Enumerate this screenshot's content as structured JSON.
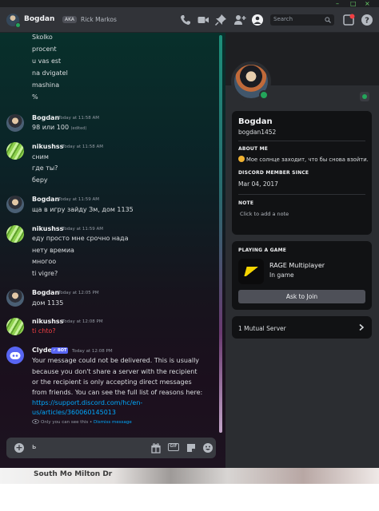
{
  "header": {
    "name": "Bogdan",
    "aka": "AKA",
    "alias": "Rick Markos",
    "search_placeholder": "Search",
    "icons": [
      "phone-icon",
      "video-icon",
      "pin-icon",
      "add-friend-icon",
      "user-profile-icon",
      "search-icon",
      "inbox-icon",
      "help-icon"
    ]
  },
  "chat": {
    "partial_lines": [
      "Skolko",
      "procent",
      "u vas est",
      "na dvigatel",
      "mashina",
      "%"
    ],
    "messages": [
      {
        "author": "Bogdan",
        "time": "Today at 11:58 AM",
        "lines": [
          "98 или  100"
        ],
        "edited": "(edited)"
      },
      {
        "author": "nikushss",
        "time": "Today at 11:58 AM",
        "lines": [
          "сним",
          "где ты?",
          "беру"
        ]
      },
      {
        "author": "Bogdan",
        "time": "Today at 11:59 AM",
        "lines": [
          "ща в игру зайду Зм, дом 1135"
        ]
      },
      {
        "author": "nikushss",
        "time": "Today at 11:59 AM",
        "lines": [
          "еду просто мне срочно нада",
          "нету времиа",
          "многоо",
          "ti vigre?"
        ]
      },
      {
        "author": "Bogdan",
        "time": "Today at 12:05 PM",
        "lines": [
          "дом 1135"
        ]
      },
      {
        "author": "nikushss",
        "time": "Today at 12:08 PM",
        "lines": [
          "ti chto?"
        ]
      },
      {
        "author": "Clyde",
        "badge": "BOT",
        "time": "Today at 12:08 PM",
        "lines": [
          "Your message could not be delivered. This is usually",
          "because you don't share a server with the recipient",
          "or the recipient is only accepting direct messages",
          "from friends. You can see the full list of reasons here:"
        ],
        "link_lines": [
          "https://support.discord.com/hc/en-",
          "us/articles/360060145013"
        ],
        "note": "Only you can see this •",
        "dismiss": "Dismiss message"
      }
    ]
  },
  "input": {
    "value": "ь",
    "gif_label": "GIF"
  },
  "profile": {
    "name": "Bogdan",
    "username": "bogdan1452",
    "about_title": "ABOUT ME",
    "about_text": "Мое солнце заходит, что бы снова взойти.",
    "member_title": "DISCORD MEMBER SINCE",
    "member_date": "Mar 04, 2017",
    "note_title": "NOTE",
    "note_placeholder": "Click to add a note",
    "game_title": "PLAYING A GAME",
    "game_name": "RAGE Multiplayer",
    "game_state": "In game",
    "join_label": "Ask to Join",
    "mutual": "1 Mutual Server"
  },
  "background_window": {
    "text": "South Mo Milton Dr"
  },
  "colors": {
    "online": "#23a55a",
    "link": "#00a8fc",
    "error_text": "#f23f43",
    "bot_badge": "#5865f2"
  }
}
